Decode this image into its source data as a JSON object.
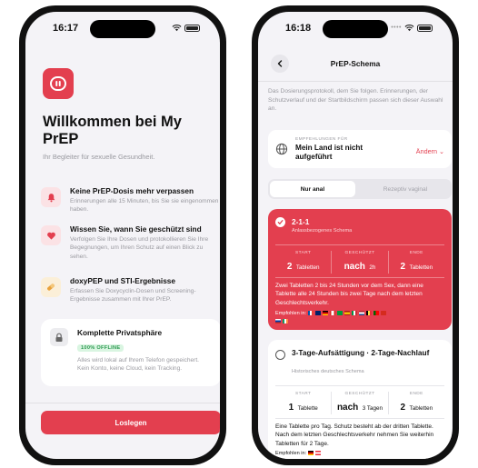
{
  "left_screen": {
    "status": {
      "time": "16:17"
    },
    "title": "Willkommen bei My PrEP",
    "tagline": "Ihr Begleiter für sexuelle Gesundheit.",
    "features": [
      {
        "icon": "bell-icon",
        "title": "Keine PrEP-Dosis mehr verpassen",
        "desc": "Erinnerungen alle 15 Minuten, bis Sie sie eingenommen haben."
      },
      {
        "icon": "heart-icon",
        "title": "Wissen Sie, wann Sie geschützt sind",
        "desc": "Verfolgen Sie Ihre Dosen und protokollieren Sie Ihre Begegnungen, um Ihren Schutz auf einen Blick zu sehen."
      },
      {
        "icon": "pill-icon",
        "title": "doxyPEP und STI-Ergebnisse",
        "desc": "Erfassen Sie Doxycyclin-Dosen und Screening-Ergebnisse zusammen mit Ihrer PrEP."
      }
    ],
    "privacy": {
      "icon": "lock-icon",
      "title": "Komplette Privatsphäre",
      "badge": "100% OFFLINE",
      "desc": "Alles wird lokal auf Ihrem Telefon gespeichert. Kein Konto, keine Cloud, kein Tracking."
    },
    "cta_label": "Loslegen"
  },
  "right_screen": {
    "status": {
      "time": "16:18"
    },
    "nav_title": "PrEP-Schema",
    "intro": "Das Dosierungsprotokoll, dem Sie folgen. Erinnerungen, der Schutzverlauf und der Startbildschirm passen sich dieser Auswahl an.",
    "recommendation": {
      "label": "EMPFEHLUNGEN FÜR",
      "country": "Mein Land ist nicht aufgeführt",
      "change": "Ändern"
    },
    "segments": {
      "active": "Nur anal",
      "inactive": "Rezeptiv vaginal"
    },
    "schemes": [
      {
        "title": "2-1-1",
        "subtitle": "Anlassbezogenes Schema",
        "start_label": "START",
        "start_value": "2",
        "start_unit": "Tabletten",
        "protected_label": "GESCHÜTZT",
        "protected_value": "nach",
        "protected_unit": "2h",
        "end_label": "ENDE",
        "end_value": "2",
        "end_unit": "Tabletten",
        "description": "Zwei Tabletten 2 bis 24 Stunden vor dem Sex, dann eine Tablette alle 24 Stunden bis zwei Tage nach dem letzten Geschlechtsverkehr.",
        "recommended_label": "Empfohlen in:"
      },
      {
        "title": "3-Tage-Aufsättigung · 2-Tage-Nachlauf",
        "subtitle": "Historisches deutsches Schema",
        "start_label": "START",
        "start_value": "1",
        "start_unit": "Tablette",
        "protected_label": "GESCHÜTZT",
        "protected_value": "nach",
        "protected_unit": "3 Tagen",
        "end_label": "ENDE",
        "end_value": "2",
        "end_unit": "Tabletten",
        "description": "Eine Tablette pro Tag. Schutz besteht ab der dritten Tablette. Nach dem letzten Geschlechtsverkehr nehmen Sie weiterhin Tabletten für 2 Tage.",
        "recommended_label": "Empfohlen in:"
      }
    ]
  },
  "colors": {
    "accent": "#e33f4f",
    "background": "#f4f3f7",
    "offline_green": "#2f9a52"
  }
}
